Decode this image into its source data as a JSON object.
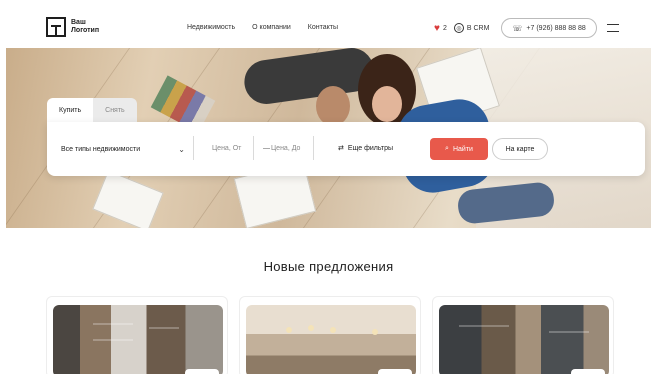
{
  "header": {
    "logo_line1": "Ваш",
    "logo_line2": "Логотип",
    "nav": [
      "Недвижимость",
      "О компании",
      "Контакты"
    ],
    "favorites_count": "2",
    "crm_label": "В CRM",
    "phone": "+7 (926) 888 88 88"
  },
  "search": {
    "tabs": [
      "Купить",
      "Снять"
    ],
    "property_type": "Все типы недвижимости",
    "price_from_placeholder": "Цена, От",
    "price_to_placeholder": "Цена, До",
    "more_filters": "Еще фильтры",
    "search_button": "Найти",
    "map_button": "На карте"
  },
  "offers": {
    "title": "Новые предложения"
  },
  "colors": {
    "accent": "#e8594b",
    "favorite": "#d93b3b"
  },
  "icons": {
    "favorite": "heart-icon",
    "crm": "crm-icon",
    "phone": "phone-icon",
    "menu": "burger-menu-icon",
    "filters": "sliders-icon",
    "search": "search-icon",
    "dropdown": "chevron-down-icon"
  }
}
